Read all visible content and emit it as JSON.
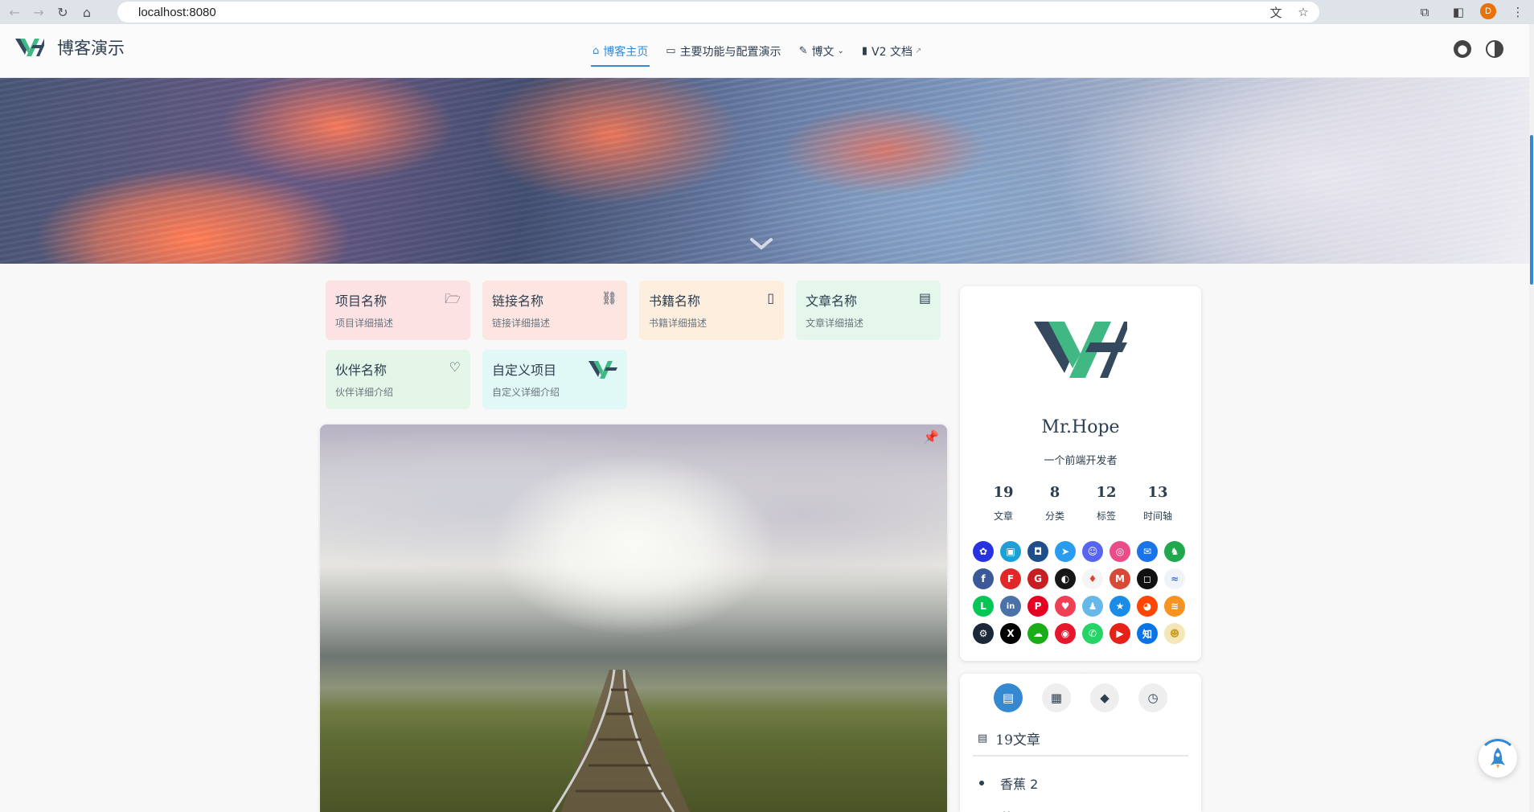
{
  "browser": {
    "url": "localhost:8080",
    "profile_initial": "D"
  },
  "navbar": {
    "site_name": "博客演示",
    "links": [
      {
        "label": "博客主页",
        "icon": "home-icon"
      },
      {
        "label": "主要功能与配置演示",
        "icon": "laptop-icon"
      },
      {
        "label": "博文",
        "icon": "edit-icon"
      },
      {
        "label": "V2 文档",
        "icon": "book-icon"
      }
    ]
  },
  "projects": [
    {
      "title": "项目名称",
      "desc": "项目详细描述",
      "icon": "folder-open-icon",
      "color": "#fde2e4"
    },
    {
      "title": "链接名称",
      "desc": "链接详细描述",
      "icon": "link-icon",
      "color": "#fde6e1"
    },
    {
      "title": "书籍名称",
      "desc": "书籍详细描述",
      "icon": "book-icon",
      "color": "#fdeedd"
    },
    {
      "title": "文章名称",
      "desc": "文章详细描述",
      "icon": "article-icon",
      "color": "#e4f7ea"
    },
    {
      "title": "伙伴名称",
      "desc": "伙伴详细介绍",
      "icon": "heart-icon",
      "color": "#e4f6e8"
    },
    {
      "title": "自定义项目",
      "desc": "自定义详细介绍",
      "icon": "vh-logo-icon",
      "color": "#e0f8f6"
    }
  ],
  "profile": {
    "name": "Mr.Hope",
    "description": "一个前端开发者",
    "stats": [
      {
        "num": "19",
        "label": "文章"
      },
      {
        "num": "8",
        "label": "分类"
      },
      {
        "num": "12",
        "label": "标签"
      },
      {
        "num": "13",
        "label": "时间轴"
      }
    ],
    "social": [
      {
        "icon": "baidu-icon",
        "color": "#2932e1",
        "glyph": "✿"
      },
      {
        "icon": "bilibili-icon",
        "color": "#1e9fd8",
        "glyph": "▣"
      },
      {
        "icon": "bitbucket-icon",
        "color": "#1f4f8a",
        "glyph": "◘"
      },
      {
        "icon": "dingding-icon",
        "color": "#2a9cf0",
        "glyph": "➤"
      },
      {
        "icon": "discord-icon",
        "color": "#5865f2",
        "glyph": "☺"
      },
      {
        "icon": "dribbble-icon",
        "color": "#ea4c89",
        "glyph": "◎"
      },
      {
        "icon": "email-icon",
        "color": "#1a73e8",
        "glyph": "✉"
      },
      {
        "icon": "evernote-icon",
        "color": "#1fa84d",
        "glyph": "♞"
      },
      {
        "icon": "facebook-icon",
        "color": "#3b5998",
        "glyph": "f"
      },
      {
        "icon": "flipboard-icon",
        "color": "#e12828",
        "glyph": "F"
      },
      {
        "icon": "gitee-icon",
        "color": "#c71d23",
        "glyph": "G"
      },
      {
        "icon": "github-icon",
        "color": "#181717",
        "glyph": "◐"
      },
      {
        "icon": "gitlab-icon",
        "color": "#f5f5f5",
        "glyph": "♦"
      },
      {
        "icon": "gmail-icon",
        "color": "#d84a38",
        "glyph": "M"
      },
      {
        "icon": "instagram-icon",
        "color": "#111111",
        "glyph": "◻"
      },
      {
        "icon": "lark-icon",
        "color": "#f0f4fa",
        "glyph": "≈"
      },
      {
        "icon": "line-icon",
        "color": "#06c755",
        "glyph": "L"
      },
      {
        "icon": "linkedin-icon",
        "color": "#4a72a8",
        "glyph": "in"
      },
      {
        "icon": "pinterest-icon",
        "color": "#e60023",
        "glyph": "P"
      },
      {
        "icon": "pocket-icon",
        "color": "#ef4056",
        "glyph": "♥"
      },
      {
        "icon": "qq-icon",
        "color": "#66b8e8",
        "glyph": "♟"
      },
      {
        "icon": "qzone-icon",
        "color": "#1a8be6",
        "glyph": "★"
      },
      {
        "icon": "reddit-icon",
        "color": "#ff4500",
        "glyph": "◕"
      },
      {
        "icon": "rss-icon",
        "color": "#f7931e",
        "glyph": "≋"
      },
      {
        "icon": "steam-icon",
        "color": "#1b2838",
        "glyph": "⚙"
      },
      {
        "icon": "twitter-x-icon",
        "color": "#000000",
        "glyph": "X"
      },
      {
        "icon": "wechat-icon",
        "color": "#1aad19",
        "glyph": "☁"
      },
      {
        "icon": "weibo-icon",
        "color": "#e6162d",
        "glyph": "◉"
      },
      {
        "icon": "whatsapp-icon",
        "color": "#25d366",
        "glyph": "✆"
      },
      {
        "icon": "youtube-icon",
        "color": "#e62117",
        "glyph": "▶"
      },
      {
        "icon": "zhihu-icon",
        "color": "#0a73e8",
        "glyph": "知"
      },
      {
        "icon": "custom-icon",
        "color": "#f5e6b8",
        "glyph": "☻"
      }
    ]
  },
  "info_panel": {
    "tabs": [
      {
        "icon": "article-list-icon",
        "active": true
      },
      {
        "icon": "category-icon",
        "active": false
      },
      {
        "icon": "tag-icon",
        "active": false
      },
      {
        "icon": "timeline-icon",
        "active": false
      }
    ],
    "heading": "19文章",
    "articles": [
      "香蕉 2",
      "苹果"
    ]
  }
}
